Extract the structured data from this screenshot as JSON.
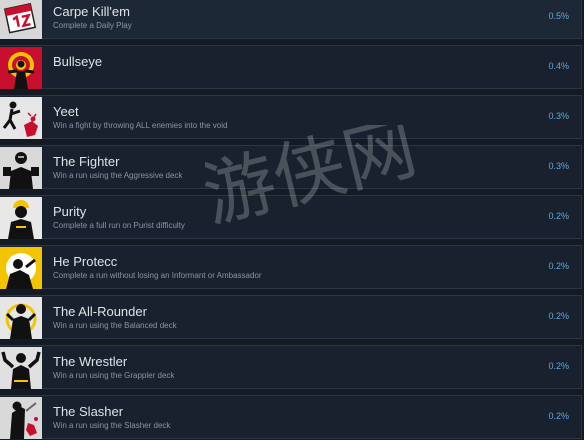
{
  "achievements": [
    {
      "title": "Carpe Kill'em",
      "description": "Complete a Daily Play",
      "percent": "0.5%",
      "icon": "calendar-day-icon"
    },
    {
      "title": "Bullseye",
      "description": "",
      "percent": "0.4%",
      "icon": "target-figure-icon"
    },
    {
      "title": "Yeet",
      "description": "Win a fight by throwing ALL enemies into the void",
      "percent": "0.3%",
      "icon": "throw-icon"
    },
    {
      "title": "The Fighter",
      "description": "Win a run using the Aggressive deck",
      "percent": "0.3%",
      "icon": "fighter-icon"
    },
    {
      "title": "Purity",
      "description": "Complete a full run on Purist difficulty",
      "percent": "0.2%",
      "icon": "purist-icon"
    },
    {
      "title": "He Protecc",
      "description": "Complete a run without losing an Informant or Ambassador",
      "percent": "0.2%",
      "icon": "protector-icon"
    },
    {
      "title": "The All-Rounder",
      "description": "Win a run using the Balanced deck",
      "percent": "0.2%",
      "icon": "all-rounder-icon"
    },
    {
      "title": "The Wrestler",
      "description": "Win a run using the Grappler deck",
      "percent": "0.2%",
      "icon": "wrestler-icon"
    },
    {
      "title": "The Slasher",
      "description": "Win a run using the Slasher deck",
      "percent": "0.2%",
      "icon": "slasher-icon"
    }
  ],
  "watermark": "游侠网",
  "colors": {
    "background": "#141b25",
    "row": "#18212d",
    "border": "#2a3646",
    "title": "#dfe3e6",
    "description": "#8a96a3",
    "percent": "#66a8d8",
    "icon_red": "#c8102e",
    "icon_yellow": "#f5c400"
  }
}
